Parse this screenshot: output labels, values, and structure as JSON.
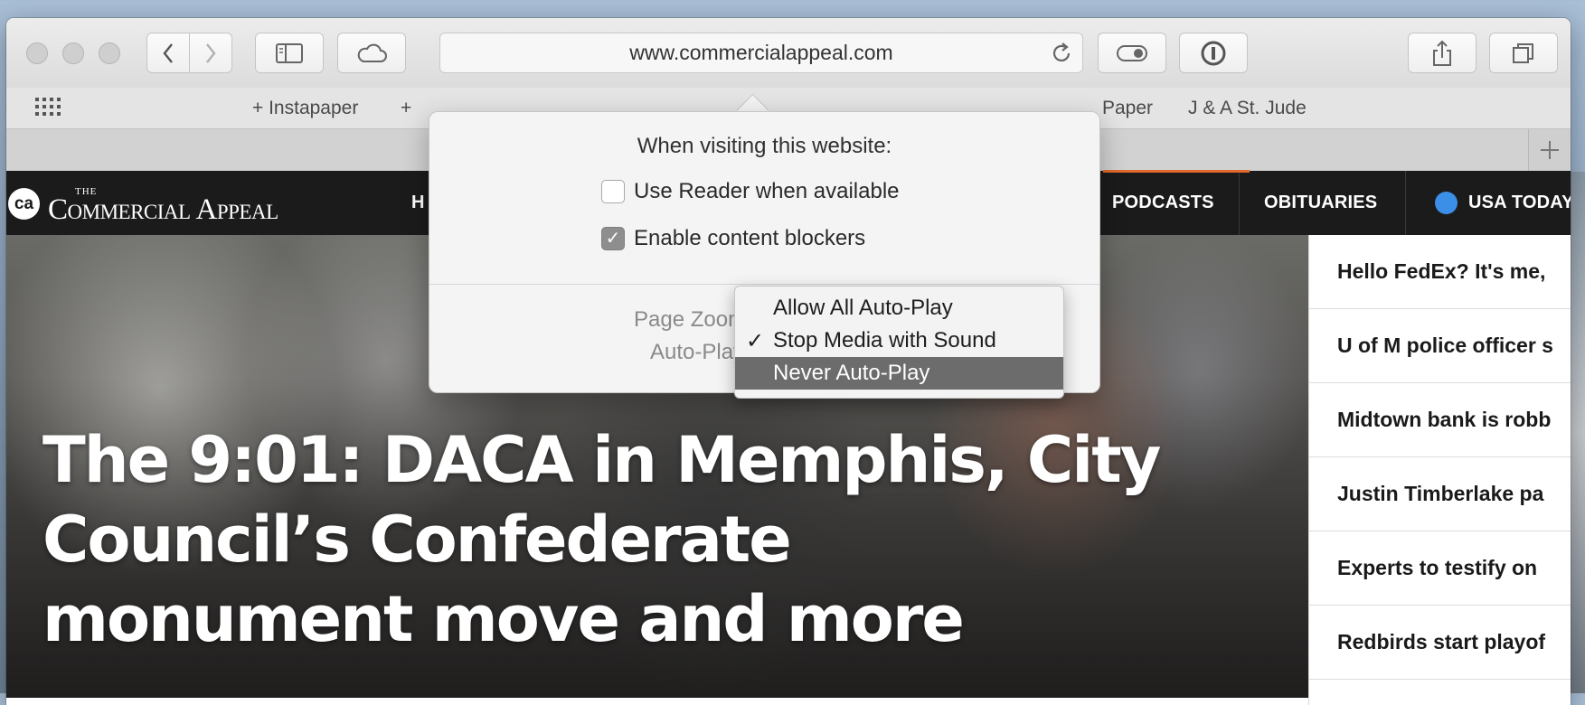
{
  "browser": {
    "url": "www.commercialappeal.com",
    "bookmarks": [
      "+ Instapaper",
      "+",
      "Paper",
      "J & A St. Jude"
    ]
  },
  "site": {
    "logo_small": "THE",
    "logo_text": "Commercial Appeal",
    "logo_mark": "ca",
    "nav": {
      "partial_first": "H",
      "podcasts": "PODCASTS",
      "obituaries": "OBITUARIES",
      "usa_today": "USA TODAY"
    },
    "headline": "The 9:01: DACA in Memphis, City Council’s Confederate monument move and more",
    "stories": [
      "Hello FedEx? It's me,",
      "U of M police officer s",
      "Midtown bank is robb",
      "Justin Timberlake pa",
      "Experts to testify on",
      "Redbirds start playof"
    ]
  },
  "popover": {
    "title": "When visiting this website:",
    "reader_label": "Use Reader when available",
    "reader_checked": false,
    "blockers_label": "Enable content blockers",
    "blockers_checked": true,
    "zoom_label": "Page Zoom",
    "autoplay_label": "Auto-Play",
    "menu": {
      "options": [
        "Allow All Auto-Play",
        "Stop Media with Sound",
        "Never Auto-Play"
      ],
      "checked": "Stop Media with Sound",
      "highlighted": "Never Auto-Play"
    }
  }
}
